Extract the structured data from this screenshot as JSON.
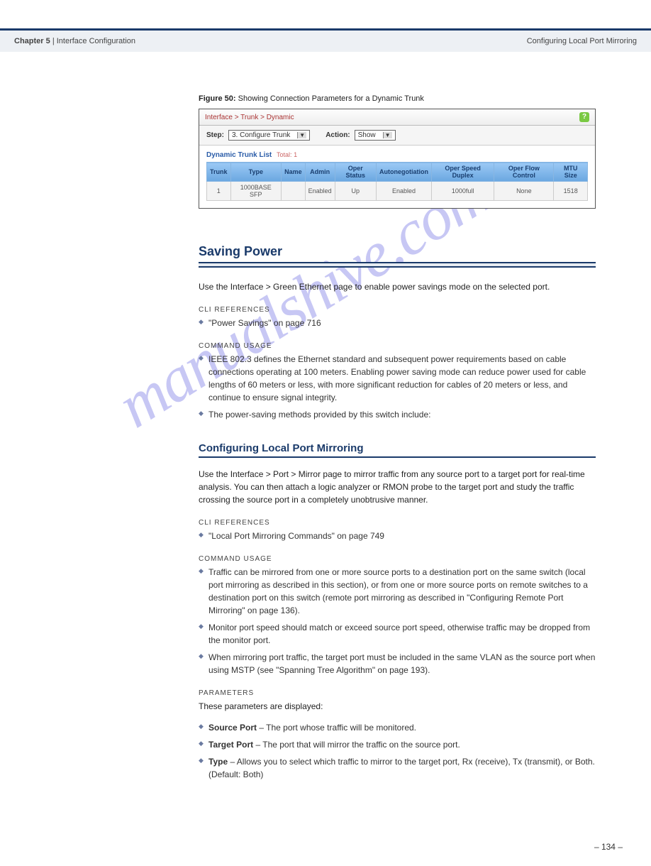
{
  "header": {
    "chapter": "Chapter 5",
    "separator": "|",
    "title": "Interface Configuration",
    "subtitle": "Configuring Local Port Mirroring"
  },
  "figure": {
    "label_prefix": "Figure 50:",
    "label_text": "Showing Connection Parameters for a Dynamic Trunk"
  },
  "app": {
    "breadcrumb": "Interface > Trunk > Dynamic",
    "toolbar": {
      "step_label": "Step:",
      "step_value": "3. Configure Trunk",
      "action_label": "Action:",
      "action_value": "Show"
    },
    "list_title": "Dynamic Trunk List",
    "total_label": "Total:",
    "total_value": "1",
    "columns": {
      "trunk": "Trunk",
      "type": "Type",
      "name": "Name",
      "admin": "Admin",
      "oper_status": "Oper Status",
      "autoneg": "Autonegotiation",
      "oper_speed": "Oper Speed Duplex",
      "oper_flow": "Oper Flow Control",
      "mtu": "MTU Size"
    },
    "rows": [
      {
        "trunk": "1",
        "type": "1000BASE SFP",
        "name": "",
        "admin": "Enabled",
        "oper_status": "Up",
        "autoneg": "Enabled",
        "oper_speed": "1000full",
        "oper_flow": "None",
        "mtu": "1518"
      }
    ]
  },
  "section1": {
    "heading": "Saving Power",
    "bar": "",
    "para1": "Use the Interface > Green Ethernet page to enable power savings mode on the selected port.",
    "cmd_heading": "CLI REFERENCES",
    "cli_item": "\"Power Savings\" on page 716",
    "cmd_heading2": "COMMAND USAGE",
    "usage_item1_lead": "IEEE 802.3 defines the Ethernet standard and subsequent power requirements based on cable connections operating at 100 meters. Enabling power saving mode can reduce power used for cable lengths of 60 meters or less, with more significant reduction for cables of 20 meters or less, and continue to ensure signal integrity.",
    "usage_item2_lead": "The power-saving methods provided by this switch include:"
  },
  "section2": {
    "heading": "Configuring Local Port Mirroring",
    "para1": "Use the Interface > Port > Mirror page to mirror traffic from any source port to a target port for real-time analysis. You can then attach a logic analyzer or RMON probe to the target port and study the traffic crossing the source port in a completely unobtrusive manner.",
    "cmd_heading": "CLI REFERENCES",
    "cli_item": "\"Local Port Mirroring Commands\" on page 749",
    "cmd_heading2": "COMMAND USAGE",
    "usage_item1": "Traffic can be mirrored from one or more source ports to a destination port on the same switch (local port mirroring as described in this section), or from one or more source ports on remote switches to a destination port on this switch (remote port mirroring as described in \"Configuring Remote Port Mirroring\" on page 136).",
    "usage_item2": "Monitor port speed should match or exceed source port speed, otherwise traffic may be dropped from the monitor port.",
    "usage_item3": "When mirroring port traffic, the target port must be included in the same VLAN as the source port when using MSTP (see \"Spanning Tree Algorithm\" on page 193).",
    "param_heading": "PARAMETERS",
    "param_intro": "These parameters are displayed:",
    "params": {
      "p1_b": "Source Port",
      "p1_t": " – The port whose traffic will be monitored.",
      "p2_b": "Target Port",
      "p2_t": " – The port that will mirror the traffic on the source port.",
      "p3_b": "Type",
      "p3_t": " – Allows you to select which traffic to mirror to the target port, Rx (receive), Tx (transmit), or Both. (Default: Both)"
    }
  },
  "page_number": "– 134 –",
  "watermark": "manualshive.com"
}
